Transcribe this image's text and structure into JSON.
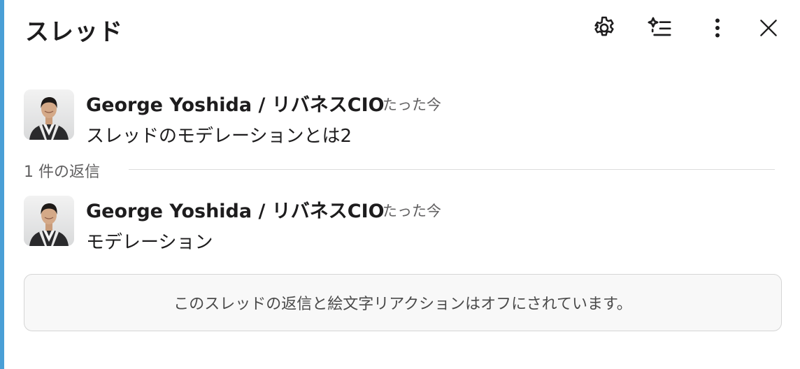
{
  "header": {
    "title": "スレッド",
    "icons": [
      "settings-gear-icon",
      "sparkle-list-icon",
      "more-vertical-icon",
      "close-icon"
    ]
  },
  "thread": {
    "parent": {
      "author": "George Yoshida / リバネスCIO",
      "time": "たった今",
      "text": "スレッドのモデレーションとは2"
    },
    "reply_count_label": "1 件の返信",
    "replies": [
      {
        "author": "George Yoshida / リバネスCIO",
        "time": "たった今",
        "text": "モデレーション"
      }
    ]
  },
  "notice": {
    "text": "このスレッドの返信と絵文字リアクションはオフにされています。"
  },
  "colors": {
    "accent": "#4a9fd6",
    "text": "#1d1c1d",
    "muted": "#616061",
    "notice_bg": "#f8f8f8",
    "notice_border": "#d5d5d5"
  }
}
